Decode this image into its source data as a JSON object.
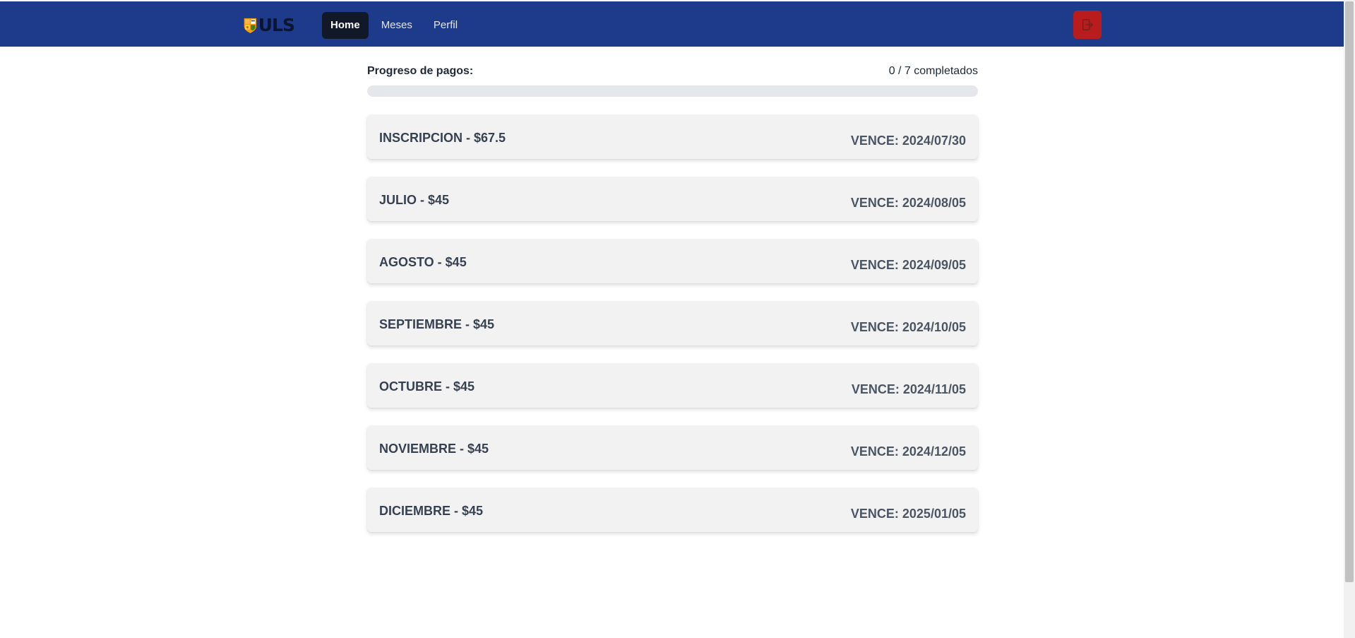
{
  "navbar": {
    "logo_text": "ULS",
    "links": [
      {
        "label": "Home",
        "active": true
      },
      {
        "label": "Meses",
        "active": false
      },
      {
        "label": "Perfil",
        "active": false
      }
    ],
    "logout_icon": "logout-icon"
  },
  "progress": {
    "label": "Progreso de pagos:",
    "count_text": "0 / 7 completados",
    "completed": 0,
    "total": 7
  },
  "payments": [
    {
      "title": "INSCRIPCION - $67.5",
      "due": "VENCE: 2024/07/30"
    },
    {
      "title": "JULIO - $45",
      "due": "VENCE: 2024/08/05"
    },
    {
      "title": "AGOSTO - $45",
      "due": "VENCE: 2024/09/05"
    },
    {
      "title": "SEPTIEMBRE - $45",
      "due": "VENCE: 2024/10/05"
    },
    {
      "title": "OCTUBRE - $45",
      "due": "VENCE: 2024/11/05"
    },
    {
      "title": "NOVIEMBRE - $45",
      "due": "VENCE: 2024/12/05"
    },
    {
      "title": "DICIEMBRE - $45",
      "due": "VENCE: 2025/01/05"
    }
  ],
  "colors": {
    "navbar": "#1e3a8a",
    "active_link": "#111827",
    "logout_button": "#b91c1c",
    "card": "#f2f2f2"
  }
}
